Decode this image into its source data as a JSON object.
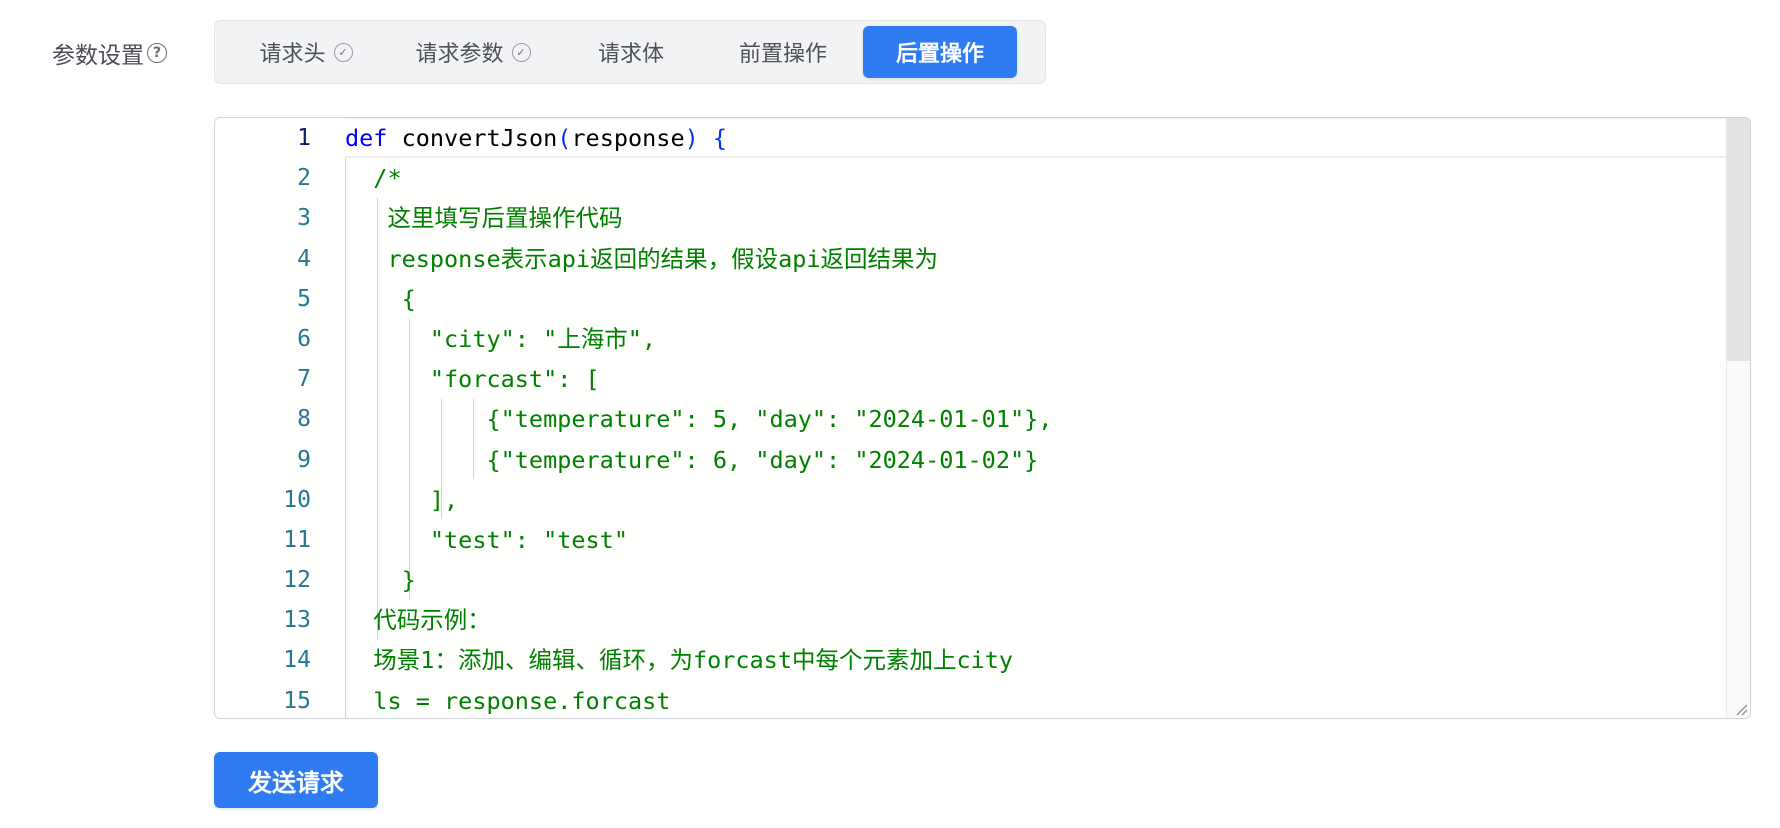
{
  "form": {
    "param_label": "参数设置",
    "help_icon": "question-circle-icon"
  },
  "tabs": [
    {
      "label": "请求头",
      "checked": true
    },
    {
      "label": "请求参数",
      "checked": true
    },
    {
      "label": "请求体",
      "checked": false
    },
    {
      "label": "前置操作",
      "checked": false
    },
    {
      "label": "后置操作",
      "checked": false,
      "active": true
    }
  ],
  "editor": {
    "line_numbers": [
      "1",
      "2",
      "3",
      "4",
      "5",
      "6",
      "7",
      "8",
      "9",
      "10",
      "11",
      "12",
      "13",
      "14",
      "15"
    ],
    "line1": {
      "kw": "def",
      "name": "convertJson",
      "open_paren": "(",
      "param": "response",
      "close_paren": ")",
      "brace": "{"
    },
    "lines": [
      "  /*",
      "   这里填写后置操作代码",
      "   response表示api返回的结果，假设api返回结果为",
      "    {",
      "      \"city\": \"上海市\",",
      "      \"forcast\": [",
      "          {\"temperature\": 5, \"day\": \"2024-01-01\"},",
      "          {\"temperature\": 6, \"day\": \"2024-01-02\"}",
      "      ],",
      "      \"test\": \"test\"",
      "    }",
      "  代码示例：",
      "  场景1：添加、编辑、循环，为forcast中每个元素加上city",
      "  ls = response.forcast"
    ]
  },
  "actions": {
    "send_label": "发送请求"
  },
  "colors": {
    "accent": "#2f7bf1",
    "comment_green": "#008000",
    "keyword_blue": "#0000ff",
    "line_number": "#237893"
  }
}
